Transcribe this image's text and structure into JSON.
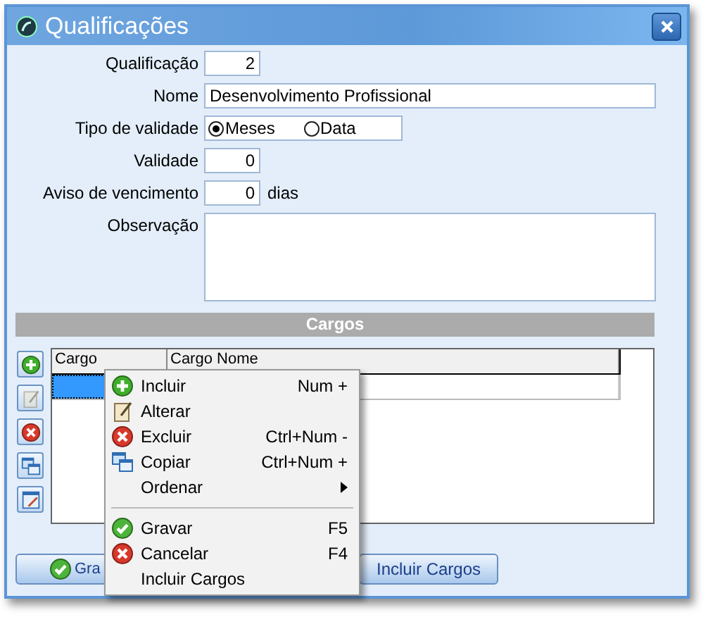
{
  "window": {
    "title": "Qualificações"
  },
  "form": {
    "fields": [
      {
        "kind": "number",
        "label": "Qualificação",
        "value": "2"
      },
      {
        "kind": "text",
        "label": "Nome",
        "value": "Desenvolvimento Profissional"
      },
      {
        "kind": "radio",
        "label": "Tipo de validade",
        "options": [
          {
            "label": "Meses",
            "selected": true
          },
          {
            "label": "Data",
            "selected": false
          }
        ]
      },
      {
        "kind": "number",
        "label": "Validade",
        "value": "0"
      },
      {
        "kind": "number",
        "label": "Aviso de vencimento",
        "value": "0",
        "suffix": "dias"
      },
      {
        "kind": "memo",
        "label": "Observação"
      }
    ]
  },
  "cargos": {
    "title": "Cargos",
    "toolbar": [
      {
        "kind": "add",
        "disabled": false
      },
      {
        "kind": "edit",
        "disabled": true
      },
      {
        "kind": "delete",
        "disabled": false
      },
      {
        "kind": "copy",
        "disabled": false
      },
      {
        "kind": "form",
        "disabled": false
      }
    ],
    "table": {
      "columns": [
        "Cargo",
        "Cargo Nome"
      ],
      "rows": [
        {
          "selected": true
        }
      ]
    }
  },
  "buttons": [
    {
      "kind": "save",
      "label": "Gra"
    },
    {
      "kind": "plain",
      "label": "Incluir Cargos"
    }
  ],
  "context_menu": [
    {
      "kind": "add",
      "label": "Incluir",
      "shortcut": "Num +"
    },
    {
      "kind": "edit",
      "label": "Alterar"
    },
    {
      "kind": "delete",
      "label": "Excluir",
      "shortcut": "Ctrl+Num -"
    },
    {
      "kind": "copy",
      "label": "Copiar",
      "shortcut": "Ctrl+Num +"
    },
    {
      "kind": "submenu",
      "label": "Ordenar"
    },
    {
      "kind": "separator"
    },
    {
      "kind": "save",
      "label": "Gravar",
      "shortcut": "F5"
    },
    {
      "kind": "delete",
      "label": "Cancelar",
      "shortcut": "F4"
    },
    {
      "kind": "plain",
      "label": "Incluir Cargos"
    }
  ]
}
